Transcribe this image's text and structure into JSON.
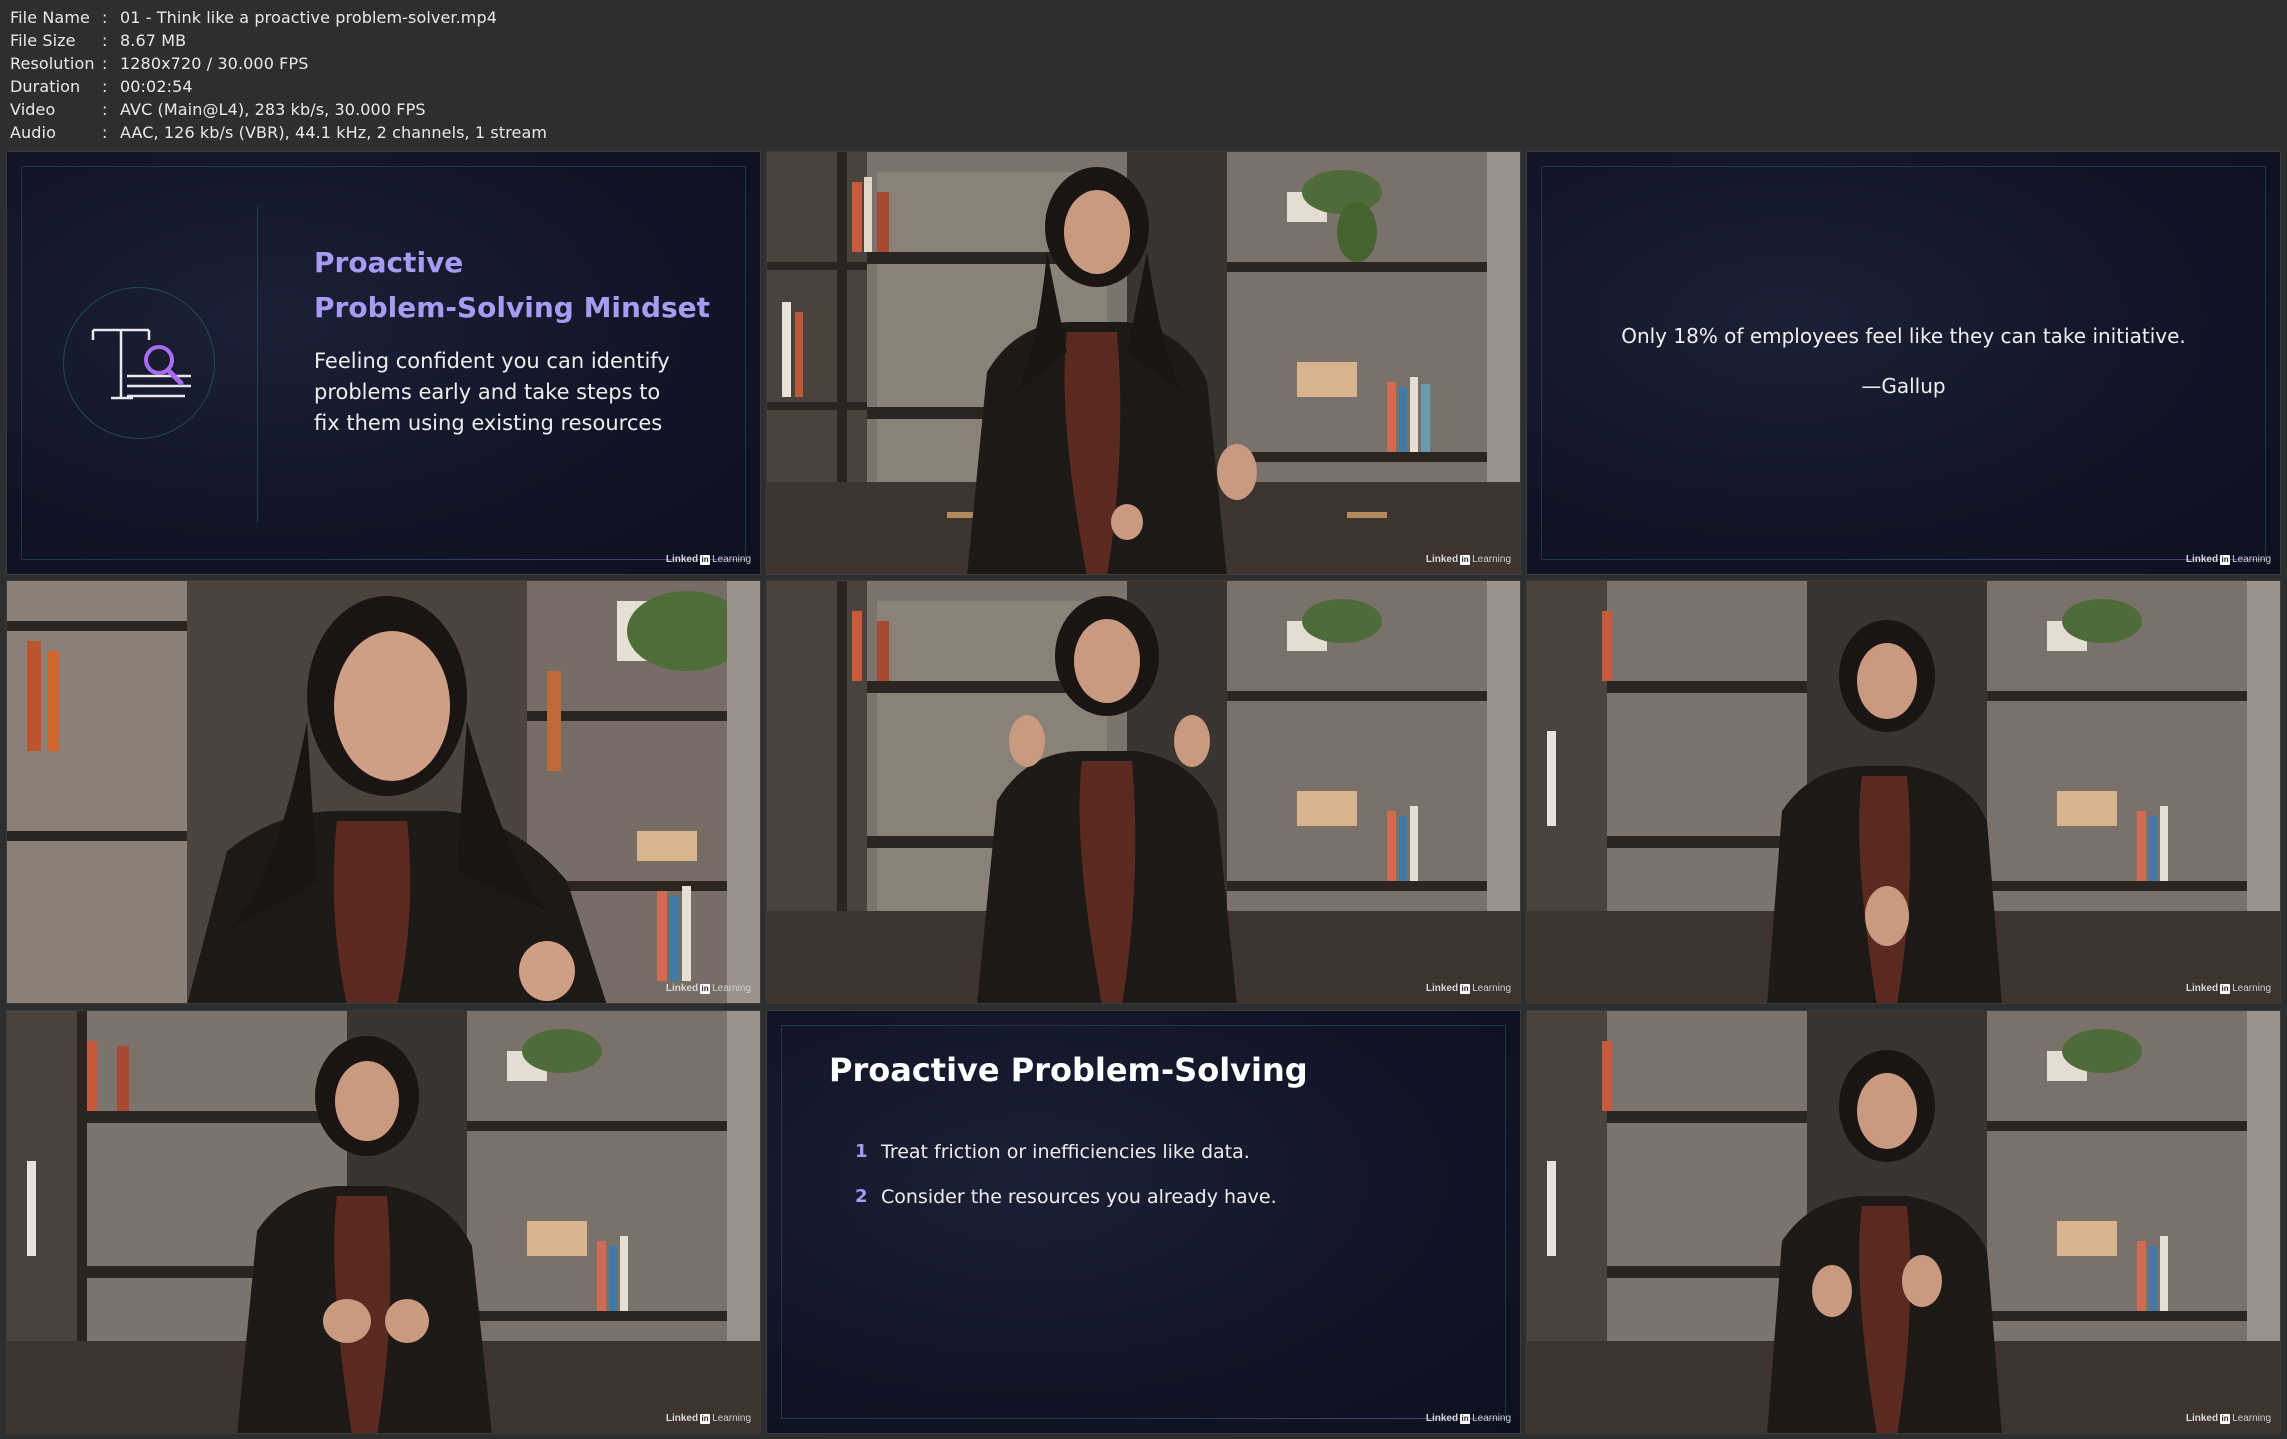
{
  "info": [
    {
      "key": "File Name",
      "sep": ":",
      "value": "01 - Think like a proactive problem-solver.mp4"
    },
    {
      "key": "File Size",
      "sep": ":",
      "value": "8.67 MB"
    },
    {
      "key": "Resolution",
      "sep": ":",
      "value": "1280x720 / 30.000 FPS"
    },
    {
      "key": "Duration",
      "sep": ":",
      "value": "00:02:54"
    },
    {
      "key": "Video",
      "sep": ":",
      "value": "AVC (Main@L4), 283 kb/s, 30.000 FPS"
    },
    {
      "key": "Audio",
      "sep": ":",
      "value": "AAC, 126 kb/s (VBR), 44.1 kHz, 2 channels, 1 stream"
    }
  ],
  "brand": {
    "part1": "Linked",
    "in": "in",
    "part2": "Learning"
  },
  "slide1": {
    "title_line1": "Proactive",
    "title_line2": "Problem-Solving Mindset",
    "body_line1": "Feeling confident you can identify",
    "body_line2": "problems early and take steps to",
    "body_line3": "fix them using existing resources"
  },
  "slide2": {
    "quote": "Only 18% of employees feel like they can take initiative.",
    "source": "—Gallup"
  },
  "slide3": {
    "title": "Proactive Problem-Solving",
    "items": [
      {
        "num": "1",
        "text": "Treat friction or inefficiencies like data."
      },
      {
        "num": "2",
        "text": "Consider the resources you already have."
      }
    ]
  },
  "colors": {
    "accent_purple": "#a79bf4",
    "slide_bg": "#121527",
    "sheet_bg": "#2e2e2e"
  },
  "icons": {
    "slide1_icon": "text-search-icon"
  }
}
